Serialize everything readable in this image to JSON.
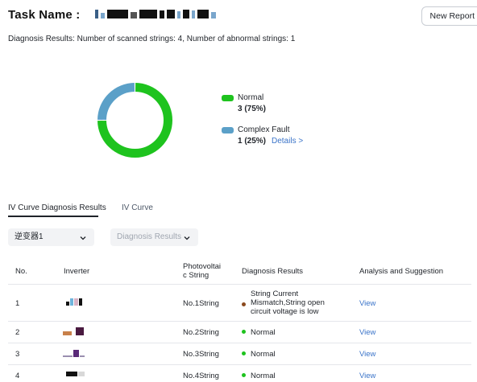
{
  "header": {
    "task_label": "Task Name :",
    "new_report_label": "New Report"
  },
  "summary": {
    "text": "Diagnosis Results: Number of scanned strings: 4, Number of abnormal strings: 1"
  },
  "legend": [
    {
      "label": "Normal",
      "value": "3 (75%)",
      "color": "#1ec31e"
    },
    {
      "label": "Complex Fault",
      "value": "1 (25%)",
      "color": "#5ba0c8",
      "link": "Details >"
    }
  ],
  "chart_data": {
    "type": "pie",
    "categories": [
      "Normal",
      "Complex Fault"
    ],
    "values": [
      3,
      1
    ],
    "percent": [
      75,
      25
    ],
    "colors": [
      "#1ec31e",
      "#5ba0c8"
    ],
    "style": "donut"
  },
  "tabs": [
    {
      "label": "IV Curve Diagnosis Results",
      "active": true
    },
    {
      "label": "IV Curve",
      "active": false
    }
  ],
  "filters": {
    "inverter": "逆变器1",
    "diagnosis_placeholder": "Diagnosis Results"
  },
  "table": {
    "columns": [
      "No.",
      "Inverter",
      "Photovoltaic String",
      "Diagnosis Results",
      "Analysis and Suggestion"
    ],
    "columns_pv_line1": "Photovoltai",
    "columns_pv_line2": "c String",
    "rows": [
      {
        "no": "1",
        "string": "No.1String",
        "diag_line1": "String Current",
        "diag_line2": "Mismatch,String open",
        "diag_line3": "circuit voltage is low",
        "status": "abnormal",
        "action": "View"
      },
      {
        "no": "2",
        "string": "No.2String",
        "diag": "Normal",
        "status": "normal",
        "action": "View"
      },
      {
        "no": "3",
        "string": "No.3String",
        "diag": "Normal",
        "status": "normal",
        "action": "View"
      },
      {
        "no": "4",
        "string": "No.4String",
        "diag": "Normal",
        "status": "normal",
        "action": "View"
      }
    ]
  }
}
